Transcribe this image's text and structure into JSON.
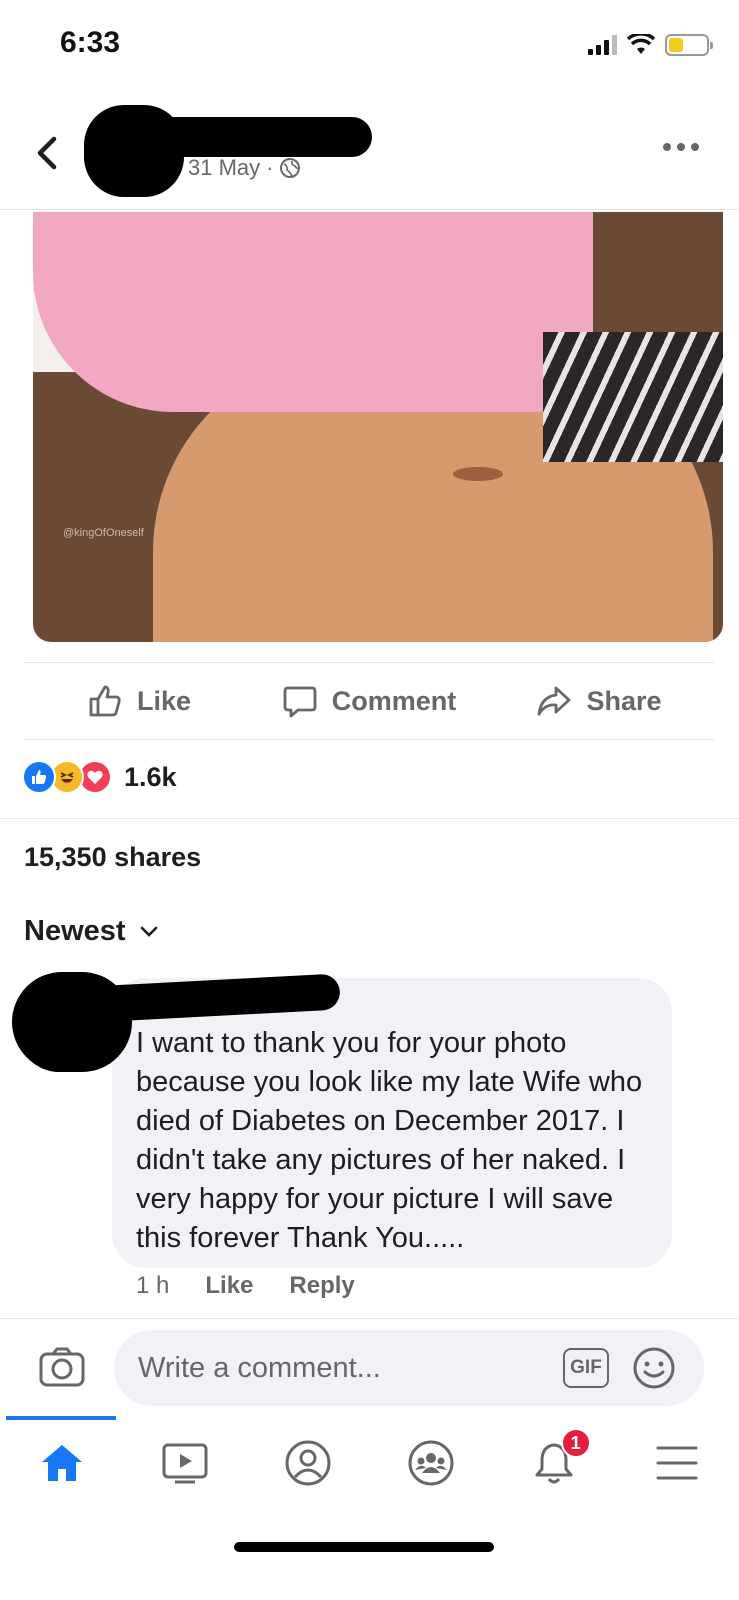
{
  "status_bar": {
    "time": "6:33"
  },
  "post": {
    "date": "31 May",
    "visibility_icon": "globe-icon",
    "photo_watermark": "@kingOfOneself"
  },
  "actions": {
    "like": "Like",
    "comment": "Comment",
    "share": "Share"
  },
  "reactions": {
    "icons": [
      "like-reaction-icon",
      "haha-reaction-icon",
      "love-reaction-icon"
    ],
    "count": "1.6k"
  },
  "shares_text": "15,350 shares",
  "sort_label": "Newest",
  "comment": {
    "text": "I want to thank you for your photo because you look like my late Wife who died of Diabetes on December 2017. I didn't take any pictures of her naked. I very happy for your picture I will save this forever Thank You.....",
    "time": "1 h",
    "like": "Like",
    "reply": "Reply"
  },
  "compose": {
    "placeholder": "Write a comment...",
    "gif_label": "GIF"
  },
  "nav": {
    "notification_badge": "1",
    "items": [
      "home-icon",
      "video-icon",
      "profile-icon",
      "groups-icon",
      "notifications-icon",
      "menu-icon"
    ]
  },
  "colors": {
    "accent": "#1877f2",
    "text_secondary": "#65676b",
    "bubble_bg": "#f0f2f5",
    "badge": "#e41e3f"
  }
}
